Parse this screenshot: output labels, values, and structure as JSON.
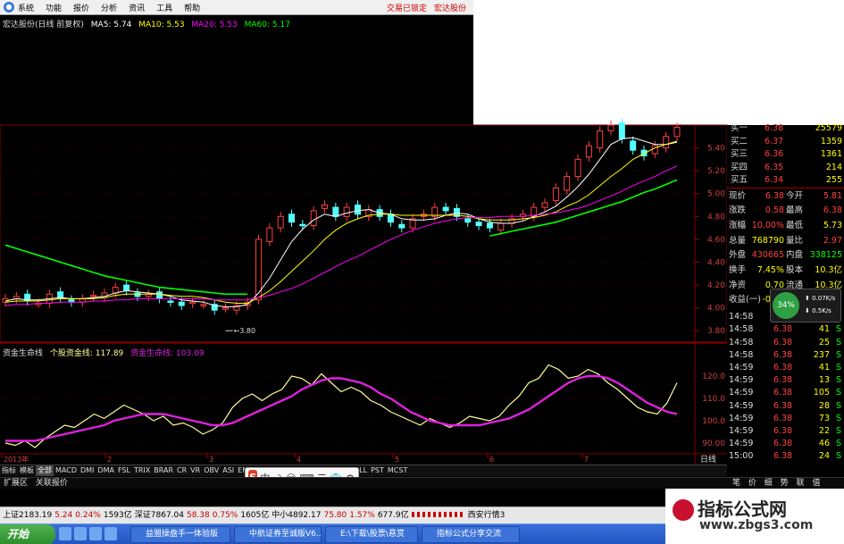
{
  "menu": {
    "items": [
      "系统",
      "功能",
      "报价",
      "分析",
      "资讯",
      "工具",
      "帮助"
    ],
    "right": [
      "交易已锁定",
      "宏达股份"
    ]
  },
  "main_legend": {
    "title": "宏达股份(日线 前复权)",
    "ma": [
      {
        "label": "MA5: 5.74",
        "color": "#ffffff"
      },
      {
        "label": "MA10: 5.53",
        "color": "#ffff00"
      },
      {
        "label": "MA20: 5.53",
        "color": "#ff00ff"
      },
      {
        "label": "MA60: 5.17",
        "color": "#00ff00"
      }
    ]
  },
  "price_axis": [
    "5.40",
    "5.20",
    "5.00",
    "4.80",
    "4.60",
    "4.40",
    "4.20",
    "4.00",
    "3.80"
  ],
  "low_label": "3.80",
  "sub_legend": {
    "title": "资金生命线",
    "main": "个股资金线: 117.89",
    "alt": "资金生命线: 103.09"
  },
  "sub_axis": [
    "120.0",
    "110.0",
    "100.0",
    "90.00"
  ],
  "x_axis": [
    "2013年",
    "2",
    "3",
    "4",
    "5",
    "6",
    "7"
  ],
  "x_right_label": "日线",
  "chart_data": [
    {
      "type": "candlestick",
      "title": "宏达股份(日线 前复权)",
      "ylim": [
        3.7,
        5.6
      ],
      "low_label": 3.8,
      "series": [
        {
          "name": "close",
          "values": [
            4.08,
            4.1,
            4.06,
            4.04,
            4.12,
            4.09,
            4.05,
            4.08,
            4.11,
            4.13,
            4.18,
            4.15,
            4.1,
            4.12,
            4.08,
            4.05,
            4.02,
            4.05,
            4.03,
            3.98,
            4.0,
            4.02,
            4.05,
            4.6,
            4.7,
            4.8,
            4.75,
            4.72,
            4.85,
            4.9,
            4.8,
            4.88,
            4.82,
            4.86,
            4.8,
            4.75,
            4.7,
            4.78,
            4.82,
            4.88,
            4.85,
            4.8,
            4.75,
            4.72,
            4.7,
            4.74,
            4.78,
            4.82,
            4.88,
            4.92,
            5.05,
            5.15,
            5.3,
            5.42,
            5.55,
            5.6,
            5.48,
            5.38,
            5.33,
            5.42,
            5.5,
            5.58
          ]
        },
        {
          "name": "MA5",
          "values": [
            4.06,
            4.08,
            4.07,
            4.07,
            4.08,
            4.09,
            4.08,
            4.08,
            4.09,
            4.1,
            4.13,
            4.15,
            4.14,
            4.13,
            4.12,
            4.1,
            4.07,
            4.06,
            4.05,
            4.02,
            4.01,
            4.01,
            4.03,
            4.13,
            4.26,
            4.42,
            4.58,
            4.69,
            4.77,
            4.82,
            4.8,
            4.83,
            4.85,
            4.86,
            4.83,
            4.82,
            4.78,
            4.77,
            4.77,
            4.78,
            4.81,
            4.83,
            4.82,
            4.78,
            4.75,
            4.74,
            4.74,
            4.76,
            4.8,
            4.84,
            4.89,
            4.97,
            5.06,
            5.17,
            5.3,
            5.43,
            5.48,
            5.49,
            5.46,
            5.43,
            5.43,
            5.45
          ]
        },
        {
          "name": "MA10",
          "values": [
            4.05,
            4.06,
            4.06,
            4.06,
            4.07,
            4.08,
            4.08,
            4.08,
            4.08,
            4.09,
            4.11,
            4.12,
            4.12,
            4.12,
            4.12,
            4.11,
            4.1,
            4.1,
            4.09,
            4.07,
            4.05,
            4.04,
            4.04,
            4.09,
            4.15,
            4.23,
            4.32,
            4.41,
            4.5,
            4.6,
            4.68,
            4.74,
            4.78,
            4.81,
            4.82,
            4.82,
            4.81,
            4.81,
            4.81,
            4.81,
            4.81,
            4.81,
            4.8,
            4.78,
            4.77,
            4.77,
            4.77,
            4.78,
            4.79,
            4.81,
            4.84,
            4.89,
            4.93,
            4.99,
            5.07,
            5.15,
            5.22,
            5.3,
            5.35,
            5.4,
            5.43,
            5.46
          ]
        },
        {
          "name": "MA20",
          "values": [
            4.02,
            4.03,
            4.03,
            4.04,
            4.04,
            4.05,
            4.05,
            4.05,
            4.06,
            4.06,
            4.07,
            4.07,
            4.08,
            4.08,
            4.08,
            4.08,
            4.08,
            4.08,
            4.08,
            4.07,
            4.07,
            4.07,
            4.07,
            4.09,
            4.11,
            4.14,
            4.17,
            4.21,
            4.26,
            4.31,
            4.36,
            4.41,
            4.45,
            4.5,
            4.55,
            4.6,
            4.64,
            4.68,
            4.71,
            4.74,
            4.76,
            4.78,
            4.79,
            4.79,
            4.79,
            4.8,
            4.8,
            4.8,
            4.81,
            4.82,
            4.83,
            4.85,
            4.87,
            4.9,
            4.94,
            4.98,
            5.02,
            5.07,
            5.11,
            5.15,
            5.2,
            5.24
          ]
        },
        {
          "name": "MA60",
          "values": [
            4.55,
            4.52,
            4.49,
            4.46,
            4.43,
            4.4,
            4.37,
            4.34,
            4.31,
            4.28,
            4.26,
            4.24,
            4.22,
            4.2,
            4.18,
            4.17,
            4.16,
            4.15,
            4.14,
            4.13,
            4.12,
            4.12,
            4.12,
            null,
            null,
            null,
            null,
            null,
            null,
            null,
            null,
            null,
            null,
            null,
            null,
            null,
            null,
            null,
            null,
            null,
            null,
            null,
            null,
            null,
            4.63,
            4.65,
            4.67,
            4.69,
            4.71,
            4.73,
            4.75,
            4.78,
            4.81,
            4.84,
            4.87,
            4.9,
            4.93,
            4.97,
            5.01,
            5.04,
            5.08,
            5.12
          ]
        }
      ]
    },
    {
      "type": "line",
      "title": "资金生命线",
      "ylim": [
        86,
        130
      ],
      "series": [
        {
          "name": "个股资金线",
          "values": [
            90,
            89,
            91,
            88,
            92,
            95,
            98,
            97,
            100,
            103,
            101,
            104,
            107,
            105,
            103,
            100,
            102,
            98,
            99,
            97,
            94,
            96,
            99,
            106,
            110,
            112,
            109,
            112,
            114,
            120,
            119,
            116,
            121,
            117,
            113,
            115,
            113,
            109,
            107,
            104,
            102,
            100,
            98,
            101,
            99,
            97,
            99,
            102,
            101,
            100,
            102,
            107,
            111,
            117,
            119,
            125,
            123,
            119,
            120,
            123,
            121,
            117,
            114,
            110,
            106,
            104,
            103,
            108,
            117
          ]
        },
        {
          "name": "资金生命线",
          "values": [
            91,
            91,
            91,
            91,
            92,
            93,
            94,
            95,
            96,
            97,
            98,
            100,
            101,
            102,
            103,
            103,
            103,
            102,
            101,
            100,
            99,
            98,
            98,
            99,
            101,
            103,
            105,
            107,
            109,
            111,
            114,
            116,
            118,
            119,
            119,
            118,
            117,
            115,
            112,
            110,
            107,
            104,
            102,
            100,
            99,
            98,
            98,
            98,
            98,
            99,
            100,
            101,
            103,
            105,
            108,
            111,
            114,
            117,
            119,
            120,
            120,
            119,
            117,
            114,
            111,
            108,
            106,
            104,
            103
          ]
        }
      ]
    }
  ],
  "quote": {
    "buy": [
      {
        "label": "买一",
        "price": "6.38",
        "vol": "25579"
      },
      {
        "label": "买二",
        "price": "6.37",
        "vol": "1359"
      },
      {
        "label": "买三",
        "price": "6.36",
        "vol": "1361"
      },
      {
        "label": "买四",
        "price": "6.35",
        "vol": "214"
      },
      {
        "label": "买五",
        "price": "6.34",
        "vol": "255"
      }
    ],
    "stats": [
      {
        "l1": "现价",
        "v1": "6.38",
        "l2": "今开",
        "v2": "5.81",
        "c1": "#ff4040",
        "c2": "#ff4040"
      },
      {
        "l1": "涨跌",
        "v1": "0.58",
        "l2": "最高",
        "v2": "6.38",
        "c1": "#ff4040",
        "c2": "#ff4040"
      },
      {
        "l1": "涨幅",
        "v1": "10.00%",
        "l2": "最低",
        "v2": "5.73",
        "c1": "#ff4040",
        "c2": "#ffff00"
      },
      {
        "l1": "总量",
        "v1": "768790",
        "l2": "量比",
        "v2": "2.97",
        "c1": "#ffff00",
        "c2": "#ff4040"
      },
      {
        "l1": "外盘",
        "v1": "430665",
        "l2": "内盘",
        "v2": "338125",
        "c1": "#ff4040",
        "c2": "#00ff00"
      },
      {
        "l1": "换手",
        "v1": "7.45%",
        "l2": "股本",
        "v2": "10.3亿",
        "c1": "#ffff00",
        "c2": "#ffff00"
      },
      {
        "l1": "净资",
        "v1": "0.70",
        "l2": "流通",
        "v2": "10.3亿",
        "c1": "#ffff00",
        "c2": "#ffff00"
      },
      {
        "l1": "收益(一)",
        "v1": "-0.07",
        "l2": "",
        "v2": "",
        "c1": "#ffff00",
        "c2": "#ffff00"
      }
    ],
    "ticks": [
      {
        "t": "14:58",
        "p": "6.38",
        "v": "14",
        "d": "S"
      },
      {
        "t": "14:58",
        "p": "6.38",
        "v": "41",
        "d": "S"
      },
      {
        "t": "14:58",
        "p": "6.38",
        "v": "25",
        "d": "S"
      },
      {
        "t": "14:58",
        "p": "6.38",
        "v": "237",
        "d": "S"
      },
      {
        "t": "14:59",
        "p": "6.38",
        "v": "41",
        "d": "S"
      },
      {
        "t": "14:59",
        "p": "6.38",
        "v": "13",
        "d": "S"
      },
      {
        "t": "14:59",
        "p": "6.38",
        "v": "105",
        "d": "S"
      },
      {
        "t": "14:59",
        "p": "6.38",
        "v": "28",
        "d": "S"
      },
      {
        "t": "14:59",
        "p": "6.38",
        "v": "73",
        "d": "S"
      },
      {
        "t": "14:59",
        "p": "6.38",
        "v": "22",
        "d": "S"
      },
      {
        "t": "14:59",
        "p": "6.38",
        "v": "46",
        "d": "S"
      },
      {
        "t": "15:00",
        "p": "6.38",
        "v": "24",
        "d": "S"
      }
    ],
    "badge": {
      "pct": "34%",
      "up": "0.07K/s",
      "down": "0.5K/s"
    }
  },
  "tabs": [
    "指标",
    "模板",
    "全部",
    "MACD",
    "DMI",
    "DMA",
    "FSL",
    "TRIX",
    "BRAR",
    "CR",
    "VR",
    "OBV",
    "ASI",
    "EMV",
    "",
    "",
    "",
    "",
    "",
    "",
    "",
    "",
    "WVR",
    "BOLL",
    "PST",
    "MCST"
  ],
  "ime": {
    "logo": "S",
    "items": [
      "中",
      "☽",
      "☺",
      "⌨",
      "☰",
      "👕",
      "⚙"
    ]
  },
  "ext": [
    "扩展区",
    "关联报价"
  ],
  "pagetabs": [
    "笔",
    "价",
    "细",
    "势",
    "联",
    "值"
  ],
  "status": [
    "上证2183.19",
    "5.24",
    "0.24%",
    "1593亿",
    "深证7867.04",
    "58.38",
    "0.75%",
    "1605亿",
    "中小4892.17",
    "75.80",
    "1.57%",
    "677.9亿",
    "",
    "西安行情3"
  ],
  "taskbar": {
    "start": "开始",
    "windows": [
      "益盟操盘手一体验版",
      "中航证券至诚版V6...",
      "E:\\下载\\股票\\悬赏",
      "指标公式分享交流"
    ]
  },
  "watermark": {
    "title": "指标公式网",
    "url": "www.zbgs3.com"
  },
  "colors": {
    "up": "#ff4040",
    "down": "#54ffff",
    "ma5": "#ffffff",
    "ma10": "#ffff00",
    "ma20": "#ff00ff",
    "ma60": "#00ff00",
    "line1": "#ffff99",
    "line2": "#dd22dd"
  }
}
